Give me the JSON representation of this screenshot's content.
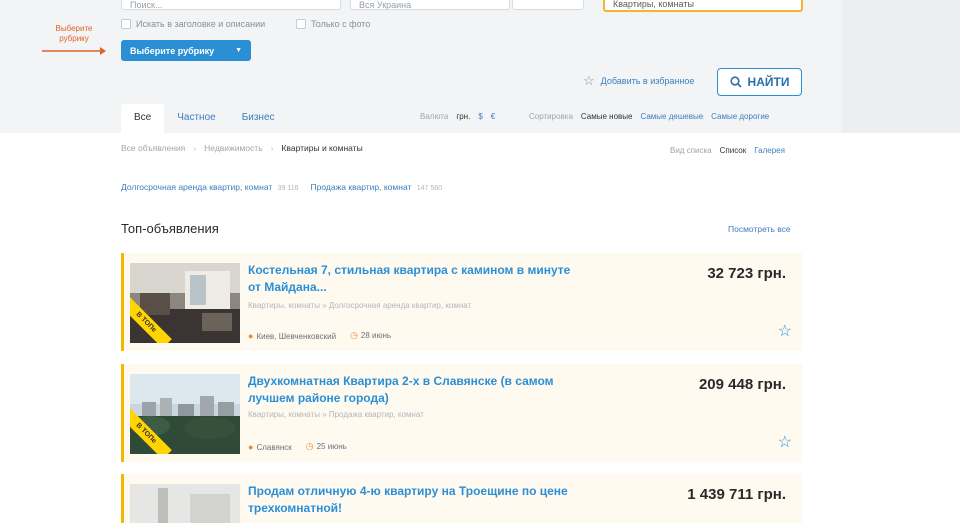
{
  "header": {
    "search_placeholder": "Поиск...",
    "city_placeholder": "Вся Украина",
    "category_value": "Квартиры, комнаты",
    "checkbox_titles": "Искать в заголовке и описании",
    "checkbox_photo": "Только с фото"
  },
  "annotation": {
    "text": "Выберите рубрику"
  },
  "rubric_button": {
    "label": "Выберите рубрику"
  },
  "favorites": {
    "label": "Добавить в избранное"
  },
  "search_button": {
    "label": "НАЙТИ"
  },
  "tabs": [
    {
      "label": "Все",
      "active": true
    },
    {
      "label": "Частное",
      "active": false
    },
    {
      "label": "Бизнес",
      "active": false
    }
  ],
  "currency": {
    "label": "Валюта",
    "options": [
      "грн.",
      "$",
      "€"
    ]
  },
  "sorting": {
    "label": "Сортировка",
    "options": [
      "Самые новые",
      "Самые дешевые",
      "Самые дорогие"
    ]
  },
  "breadcrumbs": [
    "Все объявления",
    "Недвижимость",
    "Квартиры и комнаты"
  ],
  "view": {
    "label": "Вид списка",
    "options": [
      "Список",
      "Галерея"
    ]
  },
  "subcategories": [
    {
      "label": "Долгосрочная аренда квартир, комнат",
      "count": "39 116"
    },
    {
      "label": "Продажа квартир, комнат",
      "count": "147 560"
    }
  ],
  "top_section": {
    "title": "Топ-объявления",
    "see_all": "Посмотреть все"
  },
  "ads": [
    {
      "title": "Костельная 7, стильная квартира с камином в минуте от Майдана...",
      "category": "Квартиры, комнаты » Долгосрочная аренда квартир, комнат",
      "location": "Киев, Шевченковский",
      "date": "28 июнь",
      "price": "32 723 грн.",
      "badge": "В ТОПе"
    },
    {
      "title": "Двухкомнатная Квартира 2-х в Славянске (в самом лучшем районе города)",
      "category": "Квартиры, комнаты » Продажа квартир, комнат",
      "location": "Славянск",
      "date": "25 июнь",
      "price": "209 448 грн.",
      "badge": "В ТОПе"
    },
    {
      "title": "Продам отличную 4-ю квартиру на Троещине по цене трехкомнатной!",
      "price": "1 439 711 грн."
    }
  ],
  "colors": {
    "accent": "#2b8fd6",
    "top_badge": "#ffd400",
    "top_ad_background": "#fffaf0",
    "annotation": "#e0632a"
  }
}
